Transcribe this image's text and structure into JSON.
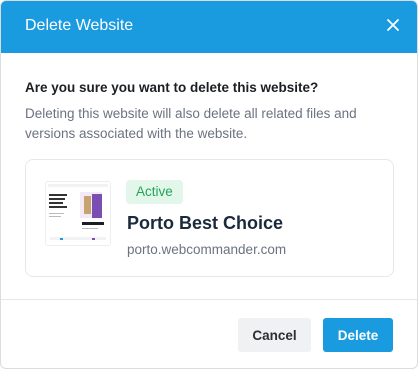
{
  "dialog": {
    "title": "Delete Website",
    "question": "Are you sure you want to delete this website?",
    "description": "Deleting this website will also delete all related files and versions associated with the website."
  },
  "website": {
    "status": "Active",
    "name": "Porto Best Choice",
    "url": "porto.webcommander.com",
    "thumbnail_headline": "Be Way You Find It Be Forever"
  },
  "buttons": {
    "cancel": "Cancel",
    "delete": "Delete"
  },
  "colors": {
    "primary": "#1a9be0",
    "active_badge_bg": "#e3f6ea",
    "active_badge_text": "#22a55a"
  },
  "icons": {
    "close": "close-icon"
  }
}
